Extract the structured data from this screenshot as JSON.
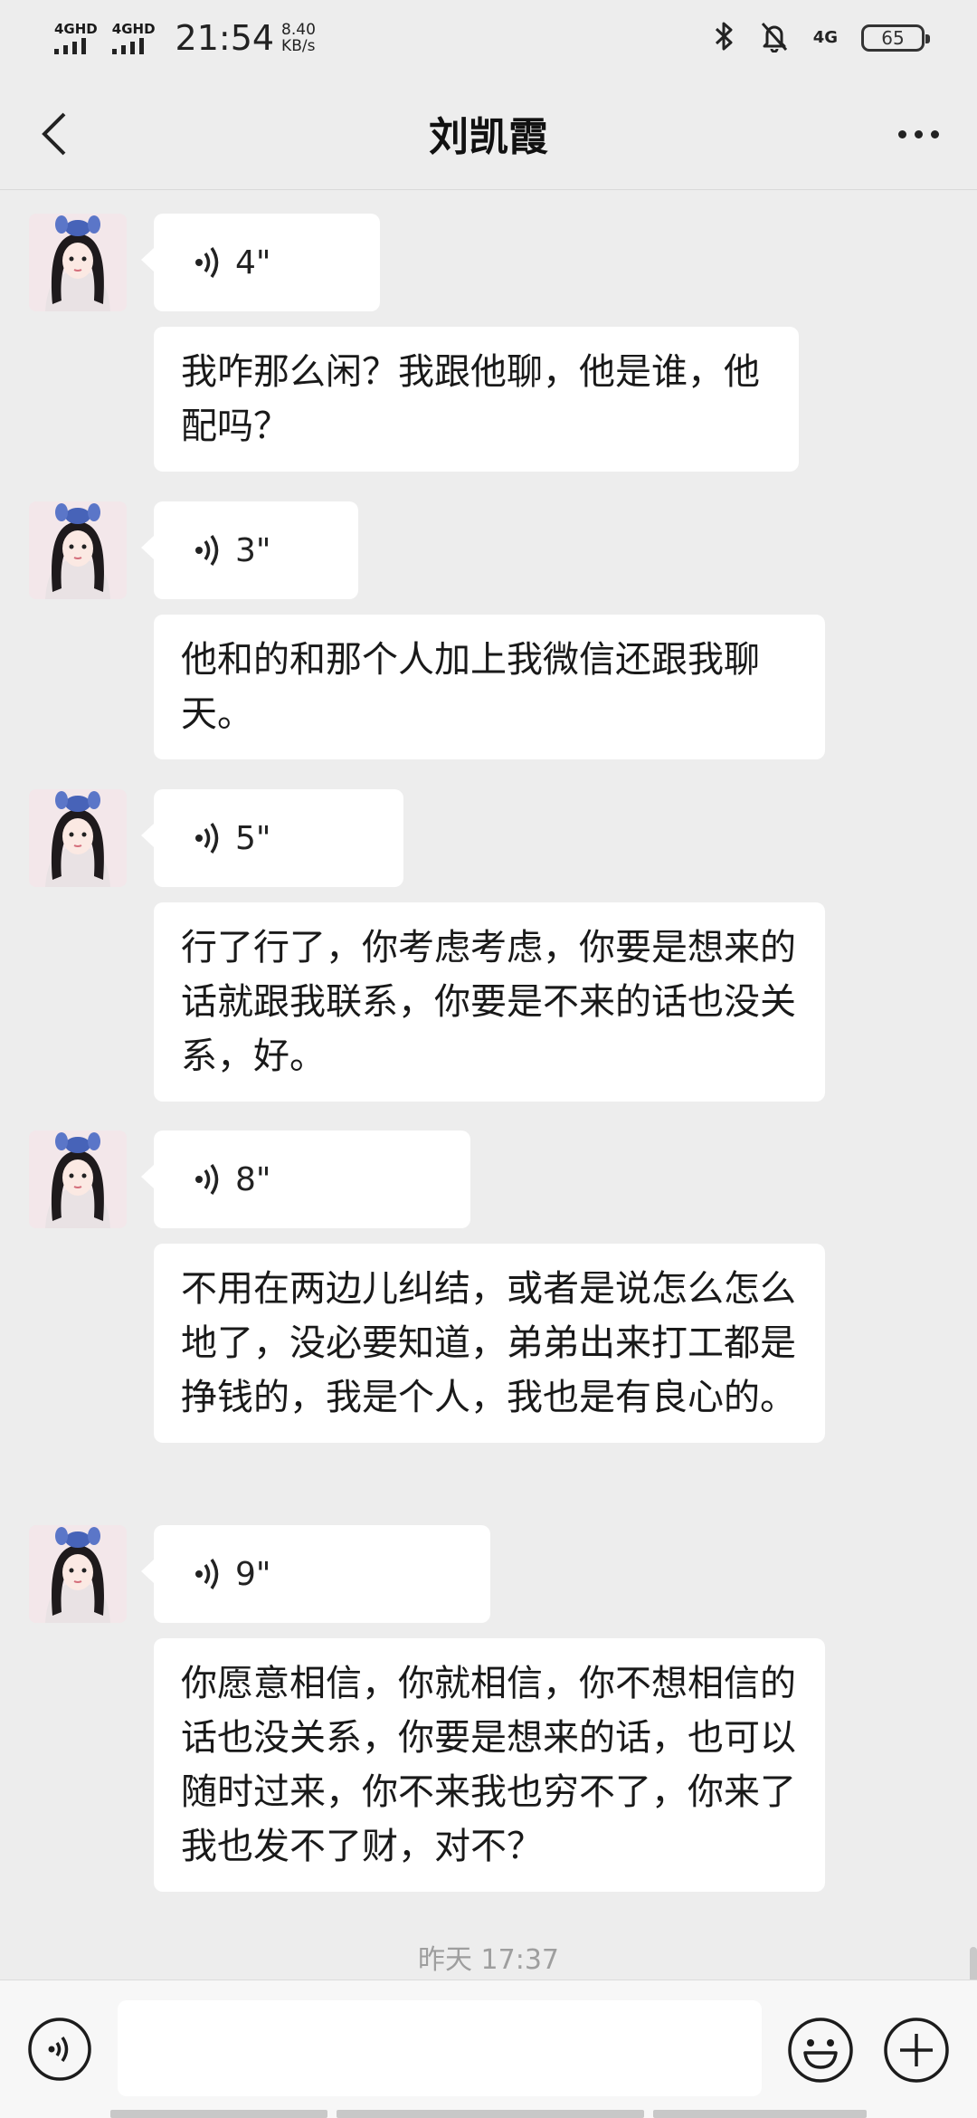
{
  "status_bar": {
    "signal1": "4GHD",
    "signal2": "4GHD",
    "time": "21:54",
    "speed_value": "8.40",
    "speed_unit": "KB/s",
    "network": "4G",
    "battery": "65",
    "icons": [
      "bluetooth-icon",
      "bell-muted-icon",
      "battery-icon"
    ]
  },
  "nav": {
    "title": "刘凯霞",
    "icons": [
      "back-arrow-icon",
      "more-dots-icon"
    ]
  },
  "messages": [
    {
      "voice": "4\"",
      "text": "我咋那么闲？我跟他聊，他是谁，他配吗？"
    },
    {
      "voice": "3\"",
      "text": "他和的和那个人加上我微信还跟我聊天。"
    },
    {
      "voice": "5\"",
      "text": "行了行了，你考虑考虑，你要是想来的话就跟我联系，你要是不来的话也没关系，好。"
    },
    {
      "voice": "8\"",
      "text": "不用在两边儿纠结，或者是说怎么怎么地了，没必要知道，弟弟出来打工都是挣钱的，我是个人，我也是有良心的。"
    },
    {
      "voice": "9\"",
      "text": "你愿意相信，你就相信，你不想相信的话也没关系，你要是想来的话，也可以随时过来，你不来我也穷不了，你来了我也发不了财，对不？"
    }
  ],
  "timestamp": "昨天 17:37",
  "input": {
    "value": "",
    "icons": [
      "voice-input-icon",
      "emoji-icon",
      "plus-icon"
    ]
  }
}
